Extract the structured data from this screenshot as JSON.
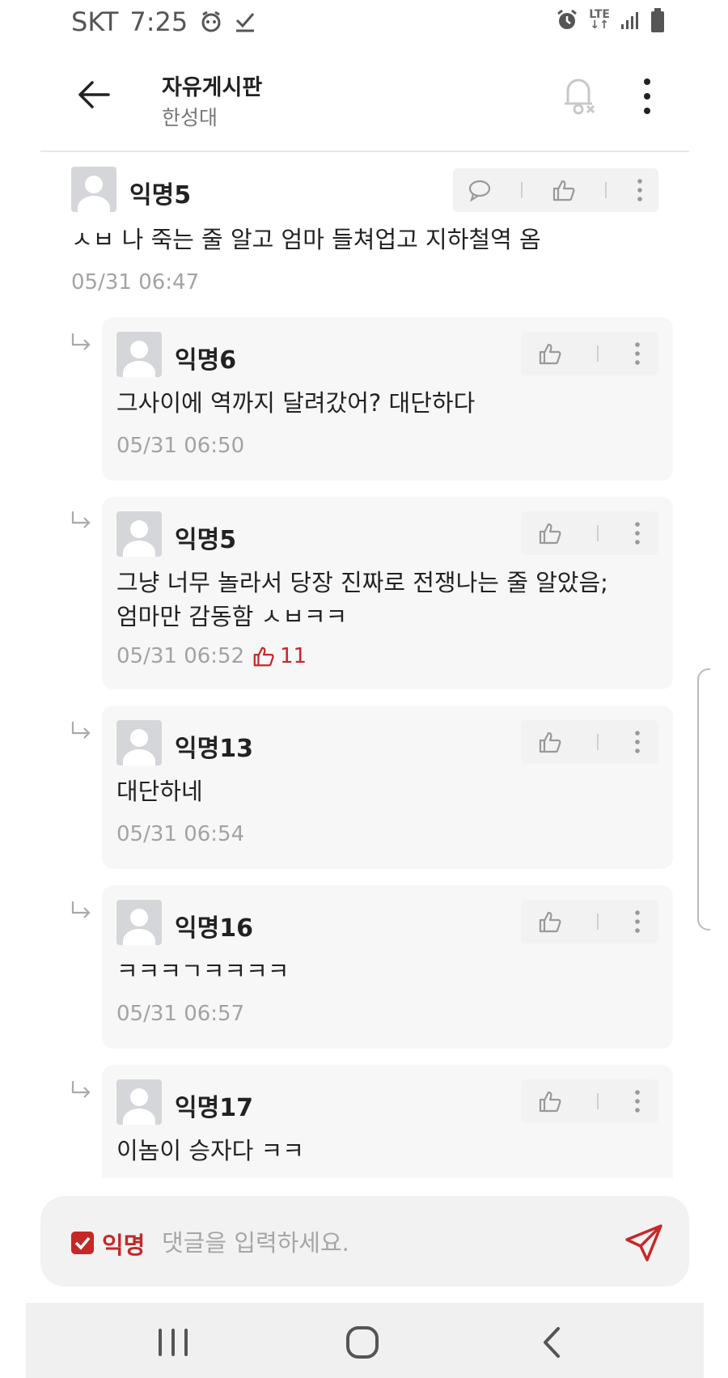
{
  "status_bar": {
    "carrier": "SKT",
    "time": "7:25",
    "network": "LTE"
  },
  "header": {
    "title": "자유게시판",
    "subtitle": "한성대"
  },
  "comments": [
    {
      "author": "익명5",
      "text": "ㅅㅂ 나 죽는 줄 알고 엄마 들쳐업고 지하철역 옴",
      "date": "05/31 06:47"
    },
    {
      "author": "익명6",
      "text": "그사이에 역까지 달려갔어? 대단하다",
      "date": "05/31 06:50"
    },
    {
      "author": "익명5",
      "text_line1": "그냥 너무 놀라서 당장 진짜로 전쟁나는 줄 알았음;",
      "text_line2": "엄마만 감동함 ㅅㅂㅋㅋ",
      "date": "05/31 06:52",
      "likes": "11"
    },
    {
      "author": "익명13",
      "text": "대단하네",
      "date": "05/31 06:54"
    },
    {
      "author": "익명16",
      "text": "ㅋㅋㅋㄱㅋㅋㅋㅋ",
      "date": "05/31 06:57"
    },
    {
      "author": "익명17",
      "text": "이놈이 승자다 ㅋㅋ"
    }
  ],
  "input": {
    "anon_label": "익명",
    "placeholder": "댓글을 입력하세요.",
    "anon_checked": true
  },
  "colors": {
    "accent": "#c62828",
    "date": "#a3a3a3",
    "reply_bg": "#f7f7f7"
  },
  "icons": {
    "back": "arrow-left-icon",
    "bell": "bell-off-icon",
    "more": "kebab-icon",
    "comment": "speech-bubble-icon",
    "like": "thumb-up-icon",
    "reply": "reply-arrow-icon",
    "send": "paper-plane-icon"
  }
}
